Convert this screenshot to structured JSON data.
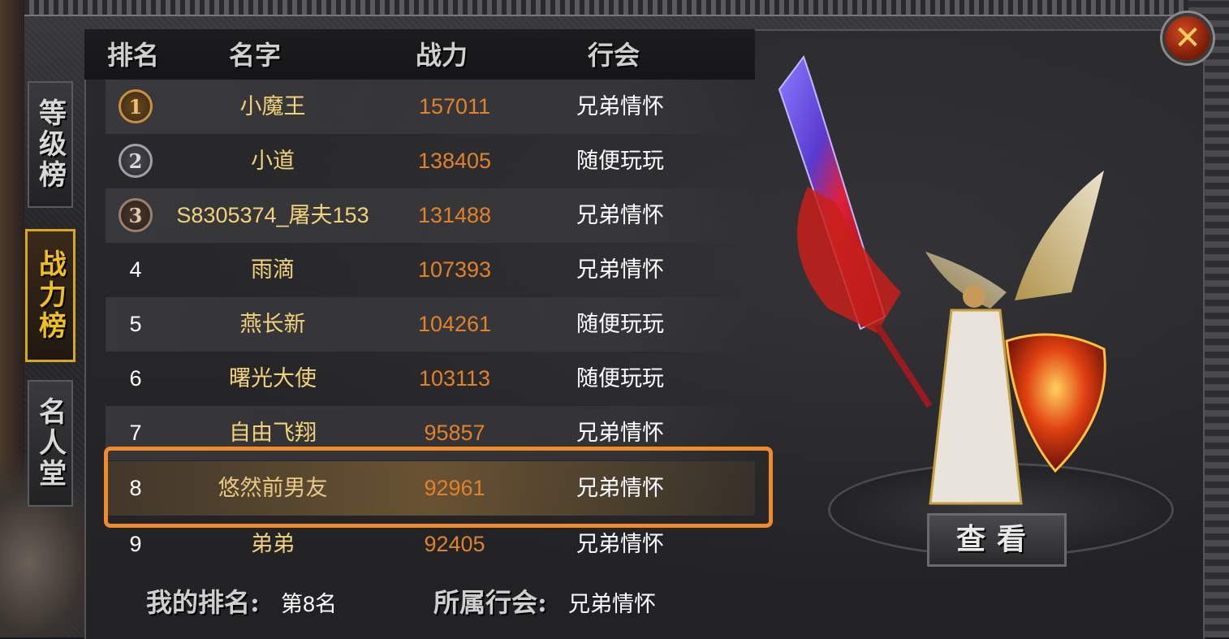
{
  "tabs": [
    {
      "label": "等级榜",
      "active": false
    },
    {
      "label": "战力榜",
      "active": true
    },
    {
      "label": "名人堂",
      "active": false
    }
  ],
  "headers": {
    "rank": "排名",
    "name": "名字",
    "power": "战力",
    "guild": "行会"
  },
  "rows": [
    {
      "rank": "1",
      "name": "小魔王",
      "power": "157011",
      "guild": "兄弟情怀"
    },
    {
      "rank": "2",
      "name": "小道",
      "power": "138405",
      "guild": "随便玩玩"
    },
    {
      "rank": "3",
      "name": "S8305374_屠夫153",
      "power": "131488",
      "guild": "兄弟情怀"
    },
    {
      "rank": "4",
      "name": "雨滴",
      "power": "107393",
      "guild": "兄弟情怀"
    },
    {
      "rank": "5",
      "name": "燕长新",
      "power": "104261",
      "guild": "随便玩玩"
    },
    {
      "rank": "6",
      "name": "曙光大使",
      "power": "103113",
      "guild": "随便玩玩"
    },
    {
      "rank": "7",
      "name": "自由飞翔",
      "power": "95857",
      "guild": "兄弟情怀"
    },
    {
      "rank": "8",
      "name": "悠然前男友",
      "power": "92961",
      "guild": "兄弟情怀"
    },
    {
      "rank": "9",
      "name": "弟弟",
      "power": "92405",
      "guild": "兄弟情怀"
    }
  ],
  "footer": {
    "my_rank_label": "我的排名:",
    "my_rank_value": "第8名",
    "guild_label": "所属行会:",
    "guild_value": "兄弟情怀"
  },
  "view_button": "查看",
  "close_icon": "close-icon",
  "colors": {
    "name": "#f2d27a",
    "power": "#e0822a",
    "highlight": "#f08a2a",
    "active_tab": "#d6a81a"
  }
}
